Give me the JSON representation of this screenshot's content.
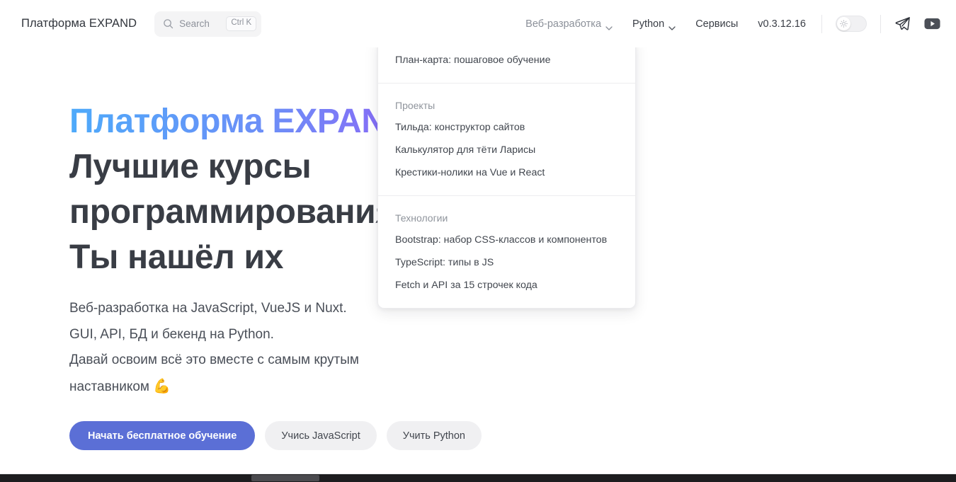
{
  "header": {
    "brand": "Платформа EXPAND",
    "search": {
      "icon": "search-icon",
      "label": "Search",
      "shortcut": "Ctrl K"
    },
    "nav": [
      {
        "label": "Веб-разработка",
        "has_caret": true,
        "active": true
      },
      {
        "label": "Python",
        "has_caret": true,
        "active": false
      },
      {
        "label": "Сервисы",
        "has_caret": false,
        "active": false
      }
    ],
    "version": "v0.3.12.16",
    "theme_toggle": {
      "icon": "sun-icon",
      "state": "light"
    },
    "social": [
      {
        "name": "telegram-icon"
      },
      {
        "name": "youtube-icon"
      }
    ]
  },
  "hero": {
    "title_gradient": "Платформа EXPAND",
    "title_line2": "Лучшие курсы",
    "title_line3": "программирования.",
    "title_line4": "Ты нашёл их",
    "sub_line1": "Веб-разработка на JavaScript, VueJS и Nuxt.",
    "sub_line2": "GUI, API, БД и бекенд на Python.",
    "sub_line3": "Давай освоим всё это вместе с самым крутым",
    "sub_line4": "наставником",
    "sub_emoji": "💪",
    "buttons": [
      {
        "label": "Начать бесплатное обучение",
        "style": "primary"
      },
      {
        "label": "Учись JavaScript",
        "style": "ghost"
      },
      {
        "label": "Учить Python",
        "style": "ghost"
      }
    ]
  },
  "dropdown": {
    "sections": [
      {
        "heading": null,
        "items": [
          "План-карта: пошаговое обучение"
        ]
      },
      {
        "heading": "Проекты",
        "items": [
          "Тильда: конструктор сайтов",
          "Калькулятор для тёти Ларисы",
          "Крестики-нолики на Vue и React"
        ]
      },
      {
        "heading": "Технологии",
        "items": [
          "Bootstrap: набор CSS-классов и компонентов",
          "TypeScript: типы в JS",
          "Fetch и API за 15 строчек кода"
        ]
      }
    ]
  },
  "colors": {
    "primary_button": "#5b6fd6",
    "gradient_start": "#4eaafa",
    "gradient_end": "#bd2bf5",
    "heading_text": "#393d45",
    "scrollbar_track": "#1d1d1f"
  }
}
